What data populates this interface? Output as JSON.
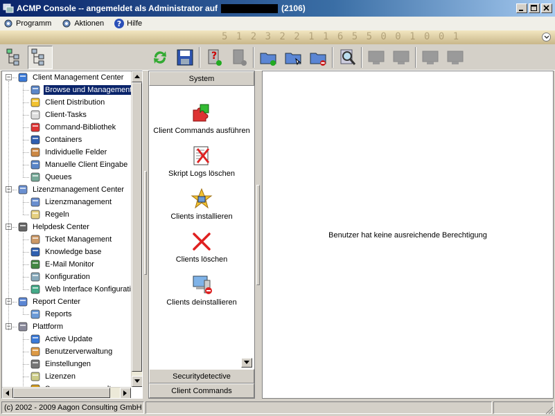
{
  "window": {
    "title_prefix": "ACMP Console -- angemeldet als Administrator auf",
    "title_suffix": "(2106)"
  },
  "menu": [
    {
      "label": "Programm",
      "icon": "gear-icon"
    },
    {
      "label": "Aktionen",
      "icon": "gear-icon"
    },
    {
      "label": "Hilfe",
      "icon": "help-icon"
    }
  ],
  "banner": {
    "digits": "5 1 2 3 2 2 1 1 6 5 5 0 0 1 0 0 1"
  },
  "toolbar": {
    "left": [
      "tree-view-icon",
      "tree-view-alt-icon"
    ],
    "right": [
      "refresh-icon",
      "save-icon",
      "computer-help-icon",
      "computer-remove-icon",
      "folder-add-icon",
      "folder-open-icon",
      "folder-remove-icon",
      "search-icon",
      "computer-icon",
      "computer-icon",
      "computer-icon",
      "computer-icon"
    ]
  },
  "tree": {
    "groups": [
      {
        "label": "Client Management Center",
        "icon": "globe-icon",
        "children": [
          {
            "label": "Browse und Management",
            "icon": "computer-icon",
            "selected": true
          },
          {
            "label": "Client Distribution",
            "icon": "star-icon"
          },
          {
            "label": "Client-Tasks",
            "icon": "document-icon"
          },
          {
            "label": "Command-Bibliothek",
            "icon": "puzzle-icon"
          },
          {
            "label": "Containers",
            "icon": "book-icon"
          },
          {
            "label": "Individuelle Felder",
            "icon": "list-icon"
          },
          {
            "label": "Manuelle Client Eingabe",
            "icon": "computer-icon"
          },
          {
            "label": "Queues",
            "icon": "queue-icon"
          }
        ]
      },
      {
        "label": "Lizenzmanagement Center",
        "icon": "license-icon",
        "children": [
          {
            "label": "Lizenzmanagement",
            "icon": "license-icon"
          },
          {
            "label": "Regeln",
            "icon": "rules-icon"
          }
        ]
      },
      {
        "label": "Helpdesk Center",
        "icon": "helpdesk-icon",
        "children": [
          {
            "label": "Ticket Management",
            "icon": "user-icon"
          },
          {
            "label": "Knowledge base",
            "icon": "book-icon"
          },
          {
            "label": "E-Mail Monitor",
            "icon": "monitor-icon"
          },
          {
            "label": "Konfiguration",
            "icon": "config-icon"
          },
          {
            "label": "Web Interface Konfiguration",
            "icon": "web-icon"
          }
        ]
      },
      {
        "label": "Report Center",
        "icon": "folder-icon",
        "children": [
          {
            "label": "Reports",
            "icon": "report-icon"
          }
        ]
      },
      {
        "label": "Plattform",
        "icon": "server-icon",
        "children": [
          {
            "label": "Active Update",
            "icon": "globe-icon"
          },
          {
            "label": "Benutzerverwaltung",
            "icon": "users-icon"
          },
          {
            "label": "Einstellungen",
            "icon": "settings-icon"
          },
          {
            "label": "Lizenzen",
            "icon": "license-doc-icon"
          },
          {
            "label": "Sperrungen verwalten",
            "icon": "lock-icon"
          }
        ]
      }
    ]
  },
  "actions": {
    "system_header": "System",
    "items": [
      {
        "label": "Client Commands ausführen",
        "icon": "puzzle-icon"
      },
      {
        "label": "Skript Logs löschen",
        "icon": "delete-log-icon"
      },
      {
        "label": "Clients installieren",
        "icon": "star-icon"
      },
      {
        "label": "Clients löschen",
        "icon": "red-x-icon"
      },
      {
        "label": "Clients deinstallieren",
        "icon": "computer-remove-icon"
      }
    ],
    "footer_headers": [
      "Securitydetective",
      "Client Commands"
    ]
  },
  "content": {
    "message": "Benutzer hat keine ausreichende Berechtigung"
  },
  "status": {
    "copyright": "(c) 2002 - 2009 Aagon Consulting GmbH"
  },
  "colors": {
    "selection": "#0a246a",
    "titlebar": "#0a246a",
    "chrome": "#d4d0c8"
  }
}
